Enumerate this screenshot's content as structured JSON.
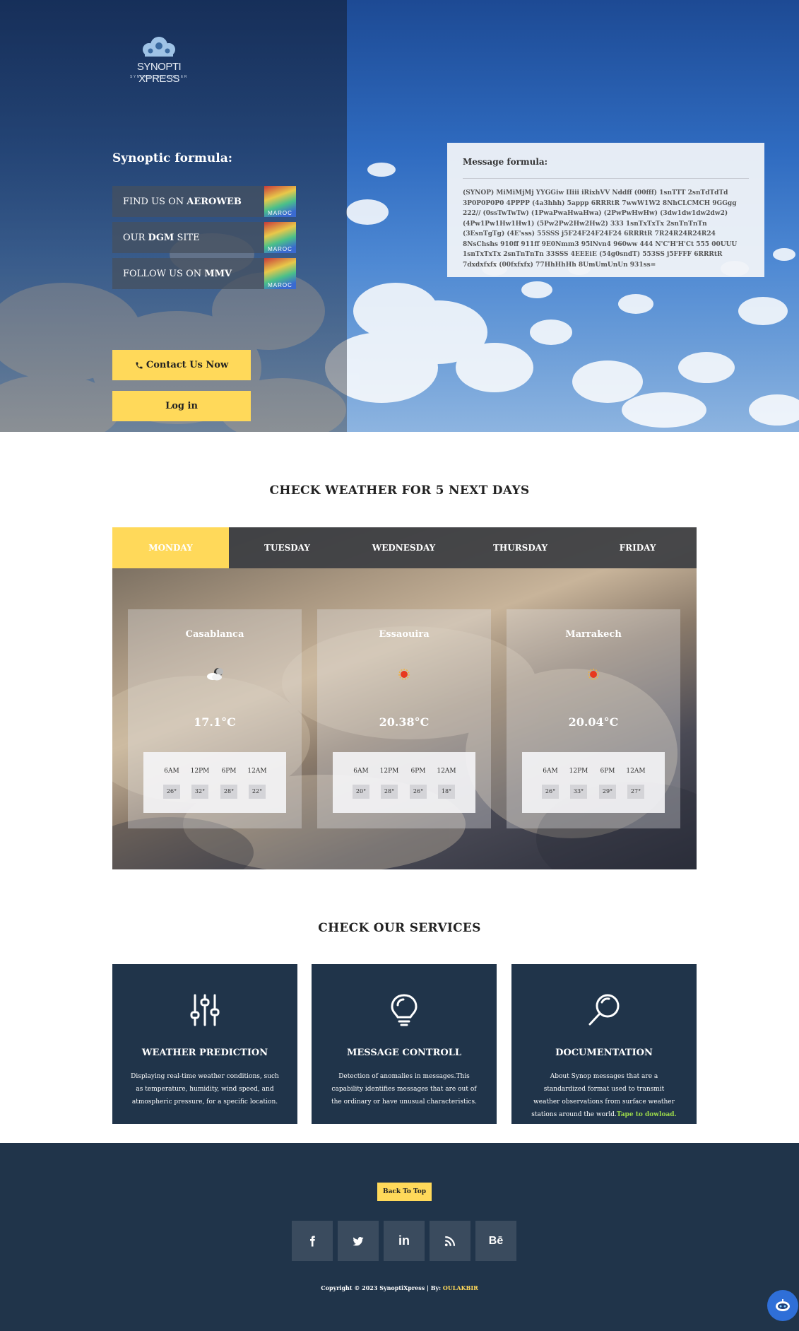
{
  "logo": {
    "name": "SYNOPTI XPRESS",
    "tagline": "SYNOPS CONTROLLER"
  },
  "hero": {
    "formula_title": "Synoptic formula:",
    "links": [
      {
        "prefix": "FIND US ON ",
        "bold": "AEROWEB",
        "badge": "MAROC"
      },
      {
        "prefix": "OUR ",
        "bold": "DGM",
        "suffix": " SITE",
        "badge": "MAROC"
      },
      {
        "prefix": "FOLLOW US ON ",
        "bold": "MMV",
        "badge": "MAROC"
      }
    ],
    "contact_button": "Contact Us Now",
    "login_button": "Log in",
    "message_title": "Message formula:",
    "message_body": "(SYNOP) MiMiMjMj YYGGiw IIiii iRixhVV Nddff (00fff) 1snTTT 2snTdTdTd 3P0P0P0P0 4PPPP (4a3hhh) 5appp 6RRRtR 7wwW1W2 8NhCLCMCH 9GGgg 222// (0ssTwTwTw) (1PwaPwaHwaHwa) (2PwPwHwHw) (3dw1dw1dw2dw2) (4Pw1Pw1Hw1Hw1) (5Pw2Pw2Hw2Hw2) 333 1snTxTxTx 2snTnTnTn (3EsnTgTg) (4E'sss) 55SSS j5F24F24F24F24 6RRRtR 7R24R24R24R24 8NsChshs 910ff 911ff 9E0Nmm3 95lNvn4 960ww 444 N'C'H'H'Ct 555 00UUU 1snTxTxTx 2snTnTnTn 33SSS 4EEEiE (54g0sndT) 553SS j5FFFF 6RRRtR 7dxdxfxfx (00fxfxfx) 77HhHhHh 8UmUmUnUn 931ss="
  },
  "weather": {
    "title": "CHECK WEATHER FOR 5 NEXT DAYS",
    "tabs": [
      "MONDAY",
      "TUESDAY",
      "WEDNESDAY",
      "THURSDAY",
      "FRIDAY"
    ],
    "active_tab": "MONDAY",
    "hour_labels": [
      "6AM",
      "12PM",
      "6PM",
      "12AM"
    ],
    "cities": [
      {
        "name": "Casablanca",
        "icon": "cloud-moon-icon",
        "temp": "17.1°C",
        "hourly": [
          "26°",
          "32°",
          "28°",
          "22°"
        ]
      },
      {
        "name": "Essaouira",
        "icon": "sun-icon",
        "temp": "20.38°C",
        "hourly": [
          "20°",
          "28°",
          "26°",
          "18°"
        ]
      },
      {
        "name": "Marrakech",
        "icon": "sun-icon",
        "temp": "20.04°C",
        "hourly": [
          "26°",
          "33°",
          "29°",
          "27°"
        ]
      }
    ]
  },
  "services": {
    "title": "CHECK OUR SERVICES",
    "items": [
      {
        "icon": "sliders-icon",
        "title": "WEATHER PREDICTION",
        "desc": "Displaying real-time weather conditions, such as temperature, humidity, wind speed, and atmospheric pressure, for a specific location.",
        "link": ""
      },
      {
        "icon": "lightbulb-icon",
        "title": "MESSAGE CONTROLL",
        "desc": "Detection of anomalies in messages.This capability identifies messages that are out of the ordinary or have unusual characteristics.",
        "link": ""
      },
      {
        "icon": "search-icon",
        "title": "DOCUMENTATION",
        "desc": "About Synop messages that are a standardized format used to transmit weather observations from surface weather stations around the world.",
        "link": "Tape to dowload."
      }
    ]
  },
  "footer": {
    "back_to_top": "Back To Top",
    "social": [
      "facebook-icon",
      "twitter-icon",
      "linkedin-icon",
      "rss-icon",
      "behance-icon"
    ],
    "behance_text": "Bē",
    "linkedin_text": "in",
    "copyright": "Copyright © 2023 SynoptiXpress | By: ",
    "author": "OULAKBIR"
  },
  "colors": {
    "accent": "#ffd95a",
    "navy": "#20344a",
    "link_green": "#9bd84a",
    "chat_blue": "#2f6fd8"
  }
}
